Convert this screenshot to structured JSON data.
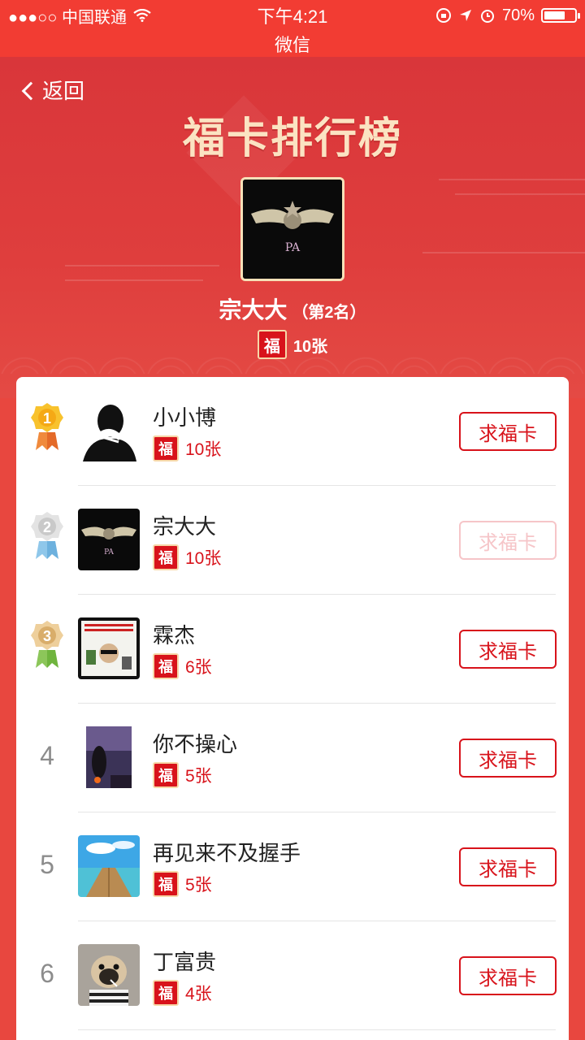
{
  "status_bar": {
    "carrier": "●●●○○ 中国联通",
    "time": "下午4:21",
    "battery": "70%",
    "battery_level": 0.7
  },
  "title_bar": {
    "title": "微信"
  },
  "header": {
    "back_label": "返回",
    "title": "福卡排行榜",
    "me": {
      "name": "宗大大",
      "rank_label": "（第2名）",
      "count": "10张"
    }
  },
  "fu_char": "福",
  "ask_label": "求福卡",
  "rankings": [
    {
      "rank": "1",
      "name": "小小博",
      "count": "10张",
      "medal": "gold"
    },
    {
      "rank": "2",
      "name": "宗大大",
      "count": "10张",
      "medal": "silver",
      "disabled": true
    },
    {
      "rank": "3",
      "name": "霖杰",
      "count": "6张",
      "medal": "bronze"
    },
    {
      "rank": "4",
      "name": "你不操心",
      "count": "5张"
    },
    {
      "rank": "5",
      "name": "再见来不及握手",
      "count": "5张"
    },
    {
      "rank": "6",
      "name": "丁富贵",
      "count": "4张"
    }
  ],
  "colors": {
    "accent": "#d8131b",
    "header_red": "#e8473f",
    "gold_text": "#fbe3c2"
  }
}
